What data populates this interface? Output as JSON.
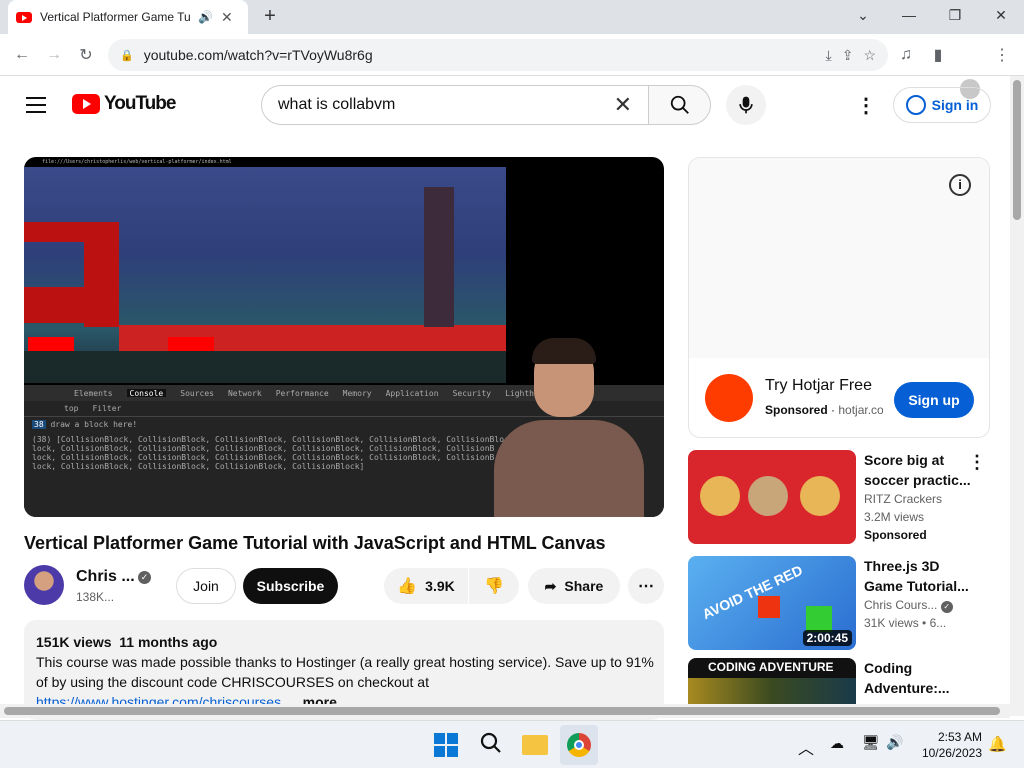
{
  "browser": {
    "tab_title": "Vertical Platformer Game Tu",
    "url": "youtube.com/watch?v=rTVoyWu8r6g"
  },
  "youtube": {
    "logo_text": "YouTube",
    "search_value": "what is collabvm",
    "sign_in": "Sign in"
  },
  "video": {
    "devtools_tabs": [
      "Elements",
      "Console",
      "Sources",
      "Network",
      "Performance",
      "Memory",
      "Application",
      "Security",
      "Lighthou"
    ],
    "filter_placeholder": "Filter",
    "context": "top",
    "console_line1": "draw a block here!",
    "console_line2": "(38) [CollisionBlock, CollisionBlock, CollisionBlock, CollisionBlock, CollisionBlock, CollisionBlock,",
    "console_line3": "lock, CollisionBlock, CollisionBlock, CollisionBlock, CollisionBlock, CollisionBlock, CollisionB",
    "console_line4": "lock, CollisionBlock, CollisionBlock, CollisionBlock, CollisionBlock, CollisionBlock, CollisionB",
    "console_line5": "lock, CollisionBlock, CollisionBlock, CollisionBlock, CollisionBlock]",
    "file_path": "file:///Users/christopherlis/web/vertical-platformer/index.html"
  },
  "watch": {
    "title": "Vertical Platformer Game Tutorial with JavaScript and HTML Canvas",
    "channel": "Chris ...",
    "subscribers": "138K...",
    "join": "Join",
    "subscribe": "Subscribe",
    "likes": "3.9K",
    "share": "Share",
    "views": "151K views",
    "age": "11 months ago",
    "desc_line1": "This course was made possible thanks to Hostinger (a really great hosting service). Save up to 91%",
    "desc_line2": "of by using the discount code CHRISCOURSES on checkout at",
    "desc_link": "https://www.hostinger.com/chriscourses",
    "more": "...more"
  },
  "ad": {
    "title": "Try Hotjar Free",
    "sponsored": "Sponsored",
    "domain": "hotjar.co",
    "cta": "Sign up"
  },
  "recs": [
    {
      "title1": "Score big at",
      "title2": "soccer practic...",
      "channel": "RITZ Crackers",
      "views": "3.2M views",
      "extra": "Sponsored"
    },
    {
      "title1": "Three.js 3D",
      "title2": "Game Tutorial...",
      "channel": "Chris Cours...",
      "views": "31K views",
      "extra": "• 6...",
      "duration": "2:00:45",
      "thumb_text": "AVOID THE RED"
    },
    {
      "title1": "Coding",
      "title2": "Adventure:...",
      "thumb_text": "CODING ADVENTURE"
    }
  ],
  "taskbar": {
    "time": "2:53 AM",
    "date": "10/26/2023"
  },
  "colors": {
    "yt_red": "#ff0000",
    "link_blue": "#065fd4",
    "hotjar_orange": "#ff3c00"
  }
}
